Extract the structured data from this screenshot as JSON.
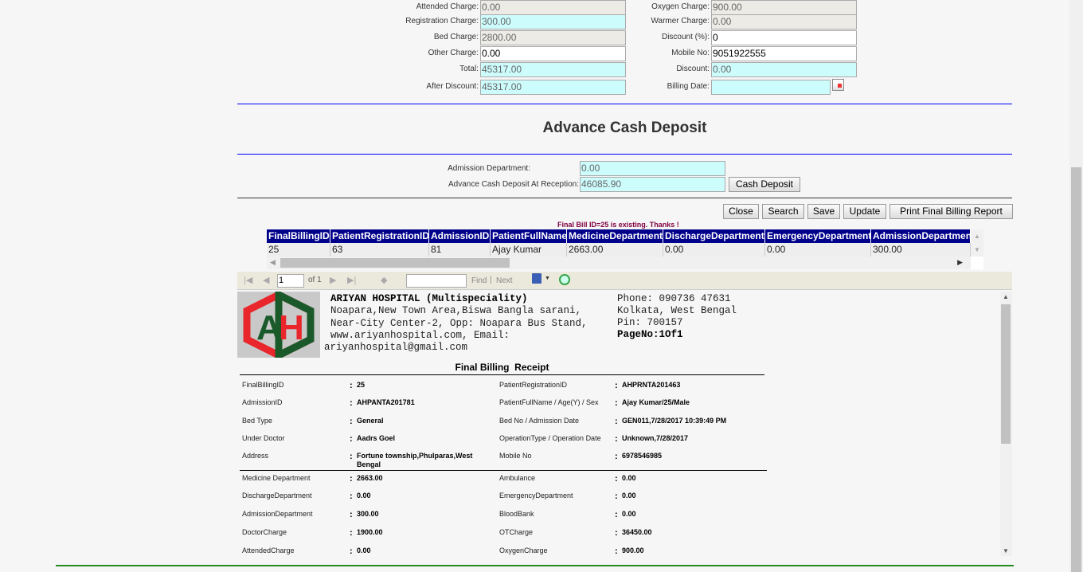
{
  "charges_left": [
    {
      "label": "Attended Charge:",
      "value": "0.00",
      "style": "gray"
    },
    {
      "label": "Registration Charge:",
      "value": "300.00",
      "style": "cyan"
    },
    {
      "label": "Bed Charge:",
      "value": "2800.00",
      "style": "gray"
    },
    {
      "label": "Other Charge:",
      "value": "0.00",
      "style": "white"
    },
    {
      "label": "Total:",
      "value": "45317.00",
      "style": "cyan"
    },
    {
      "label": "After Discount:",
      "value": "45317.00",
      "style": "cyan"
    }
  ],
  "charges_right": [
    {
      "label": "Oxygen Charge:",
      "value": "900.00",
      "style": "gray"
    },
    {
      "label": "Warmer Charge:",
      "value": "0.00",
      "style": "gray"
    },
    {
      "label": "Discount (%):",
      "value": "0",
      "style": "white"
    },
    {
      "label": "Mobile No:",
      "value": "9051922555",
      "style": "white"
    },
    {
      "label": "Discount:",
      "value": "0.00",
      "style": "cyan"
    },
    {
      "label": "Billing Date:",
      "value": "",
      "style": "cyan"
    }
  ],
  "section_title": "Advance Cash Deposit",
  "deposit": {
    "admission_label": "Admission Department:",
    "admission_value": "0.00",
    "advance_label": "Advance Cash Deposit At Reception:",
    "advance_value": "46085.90",
    "cash_deposit_button": "Cash Deposit"
  },
  "buttons": {
    "close": "Close",
    "search": "Search",
    "save": "Save",
    "update": "Update",
    "print": "Print Final Billing Report"
  },
  "status_message": "Final Bill ID=25 is existing. Thanks !",
  "grid": {
    "columns": [
      "FinalBillingID",
      "PatientRegistrationID",
      "AdmissionID",
      "PatientFullName",
      "MedicineDepartment",
      "DischargeDepartment",
      "EmergencyDepartment",
      "AdmissionDepartment"
    ],
    "rows": [
      [
        "25",
        "63",
        "81",
        "Ajay Kumar",
        "2663.00",
        "0.00",
        "0.00",
        "300.00"
      ]
    ]
  },
  "report_toolbar": {
    "page": "1",
    "of_label": "of 1",
    "find": "Find",
    "sep": "|",
    "next": "Next",
    "search_value": ""
  },
  "report": {
    "hospital_name": "ARIYAN HOSPITAL (Multispeciality)",
    "address_lines": [
      "Noapara,New Town Area,Biswa Bangla sarani,",
      "Near-City Center-2, Opp: Noapara Bus Stand,",
      "www.ariyanhospital.com, Email:"
    ],
    "email": "ariyanhospital@gmail.com",
    "phone": "Phone: 090736 47631",
    "city": "Kolkata, West Bengal",
    "pin": "Pin: 700157",
    "page_no": "PageNo:1Of1",
    "logo_text": "AH",
    "title": "Final Billing  Receipt",
    "details": [
      {
        "l1": "FinalBillingID",
        "v1": "25",
        "l2": "PatientRegistrationID",
        "v2": "AHPRNTA201463"
      },
      {
        "l1": "AdmissionID",
        "v1": "AHPANTA201781",
        "l2": "PatientFullName / Age(Y) / Sex",
        "v2": "Ajay Kumar/25/Male"
      },
      {
        "l1": "Bed Type",
        "v1": "General",
        "l2": "Bed No / Admission Date",
        "v2": "GEN011,7/28/2017 10:39:49 PM"
      },
      {
        "l1": "Under Doctor",
        "v1": "Aadrs Goel",
        "l2": "OperationType / Operation Date",
        "v2": "Unknown,7/28/2017"
      },
      {
        "l1": "Address",
        "v1": "Fortune township,Phulparas,West Bengal",
        "l2": "Mobile No",
        "v2": "6978546985"
      }
    ],
    "charges": [
      {
        "l1": "Medicine Department",
        "v1": "2663.00",
        "l2": "Ambulance",
        "v2": "0.00"
      },
      {
        "l1": "DischargeDepartment",
        "v1": "0.00",
        "l2": "EmergencyDepartment",
        "v2": "0.00"
      },
      {
        "l1": "AdmissionDepartment",
        "v1": "300.00",
        "l2": "BloodBank",
        "v2": "0.00"
      },
      {
        "l1": "DoctorCharge",
        "v1": "1900.00",
        "l2": "OTCharge",
        "v2": "36450.00"
      },
      {
        "l1": "AttendedCharge",
        "v1": "0.00",
        "l2": "OxygenCharge",
        "v2": "900.00"
      }
    ],
    "colon": ":"
  },
  "colors": {
    "divider_blue": "#0000ff",
    "grid_header": "#00008b",
    "status": "#800040",
    "footer_line": "#228b22"
  }
}
